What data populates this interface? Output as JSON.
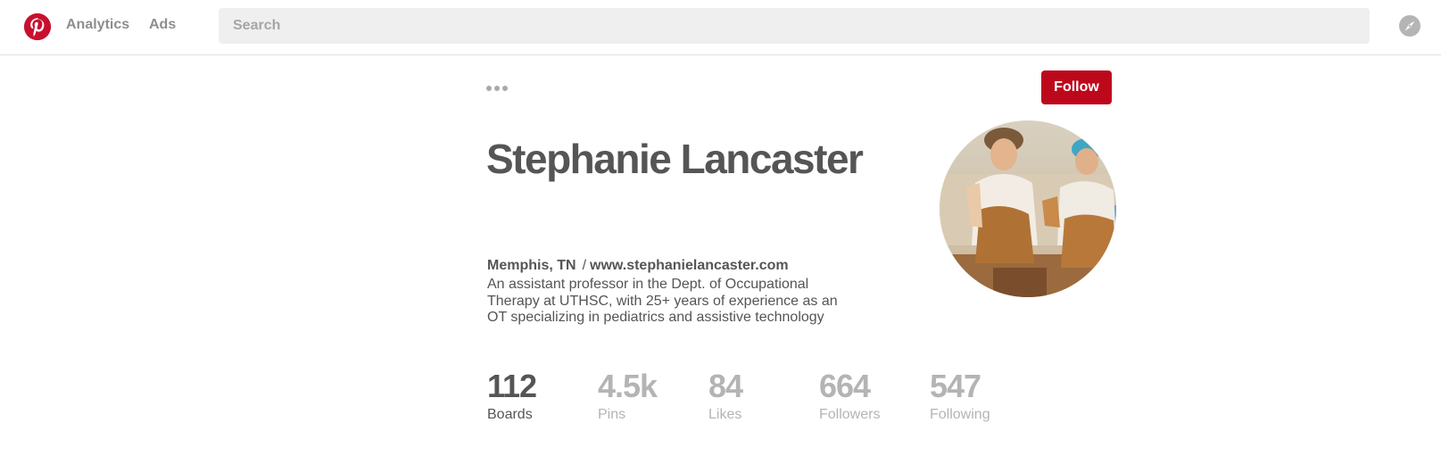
{
  "header": {
    "nav": {
      "analytics": "Analytics",
      "ads": "Ads"
    },
    "search": {
      "placeholder": "Search"
    },
    "icons": {
      "logo": "pinterest-logo-icon",
      "explore": "compass-icon"
    }
  },
  "profile": {
    "name": "Stephanie Lancaster",
    "location": "Memphis, TN",
    "separator": "/",
    "website": "www.stephanielancaster.com",
    "bio": "An assistant professor in the Dept. of Occupational Therapy at UTHSC, with 25+ years of experience as an OT specializing in pediatrics and assistive technology",
    "follow_label": "Follow",
    "more_icon": "ellipsis-icon"
  },
  "stats": [
    {
      "value": "112",
      "label": "Boards",
      "active": true
    },
    {
      "value": "4.5k",
      "label": "Pins",
      "active": false
    },
    {
      "value": "84",
      "label": "Likes",
      "active": false
    },
    {
      "value": "664",
      "label": "Followers",
      "active": false
    },
    {
      "value": "547",
      "label": "Following",
      "active": false
    }
  ],
  "colors": {
    "brand": "#bd081c",
    "text": "#555555",
    "muted": "#b4b4b4",
    "search_bg": "#efefef"
  }
}
